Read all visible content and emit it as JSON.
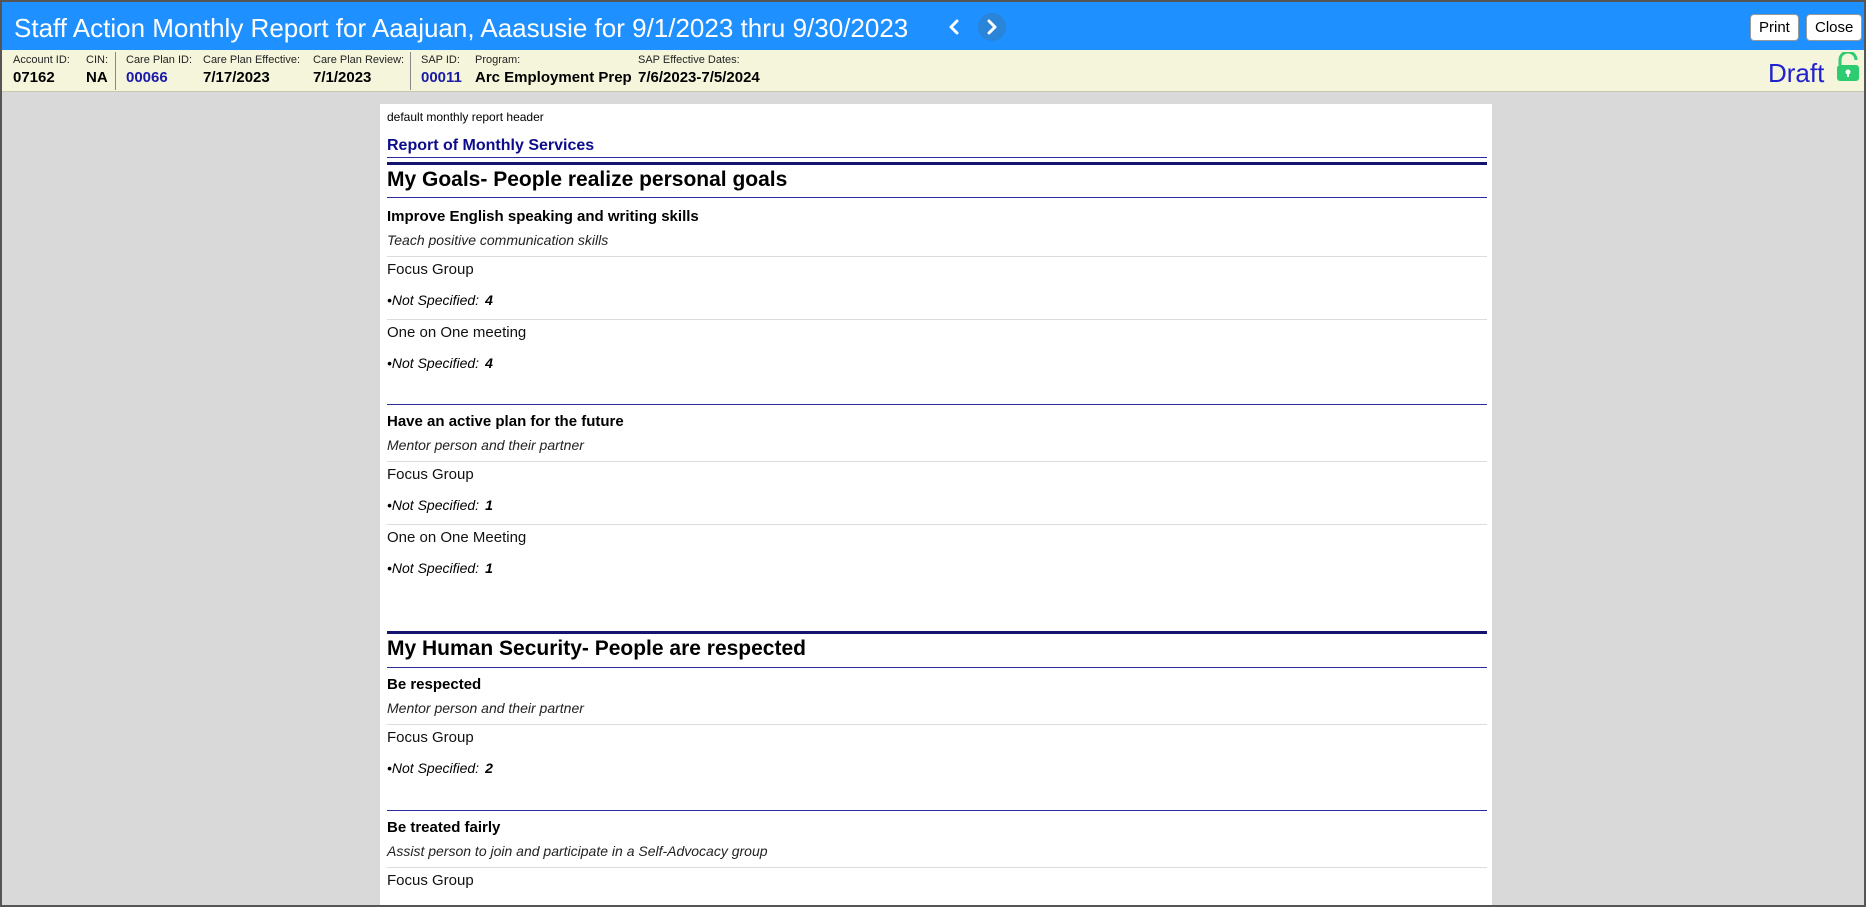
{
  "window": {
    "title": "Staff Action Monthly Report for Aaajuan, Aaasusie for 9/1/2023 thru 9/30/2023",
    "print_label": "Print",
    "close_label": "Close"
  },
  "info": {
    "account_id_label": "Account ID:",
    "account_id": "07162",
    "cin_label": "CIN:",
    "cin": "NA",
    "care_plan_id_label": "Care Plan ID:",
    "care_plan_id": "00066",
    "care_plan_effective_label": "Care Plan Effective:",
    "care_plan_effective": "7/17/2023",
    "care_plan_review_label": "Care Plan Review:",
    "care_plan_review": "7/1/2023",
    "sap_id_label": "SAP ID:",
    "sap_id": "00011",
    "program_label": "Program:",
    "program": "Arc Employment Prep",
    "sap_dates_label": "SAP Effective Dates:",
    "sap_dates": "7/6/2023-7/5/2024",
    "status": "Draft",
    "status_color": "#2222cc",
    "lock_color": "#2ecc71",
    "lock_icon": "unlock-icon"
  },
  "report": {
    "header_text": "default monthly report header",
    "title": "Report of Monthly Services",
    "domains": [
      {
        "name": "My Goals- People realize personal goals",
        "goals": [
          {
            "name": "Improve English speaking and writing skills",
            "action": "Teach positive communication skills",
            "services": [
              {
                "name": "Focus Group",
                "unit": "•Not Specified:",
                "count": "4"
              },
              {
                "name": "One on One meeting",
                "unit": "•Not Specified:",
                "count": "4"
              }
            ]
          },
          {
            "name": "Have an active plan for the future",
            "action": "Mentor person and their partner",
            "services": [
              {
                "name": "Focus Group",
                "unit": "•Not Specified:",
                "count": "1"
              },
              {
                "name": "One on One Meeting",
                "unit": "•Not Specified:",
                "count": "1"
              }
            ]
          }
        ]
      },
      {
        "name": "My Human Security- People are respected",
        "goals": [
          {
            "name": "Be respected",
            "action": "Mentor person and their partner",
            "services": [
              {
                "name": "Focus Group",
                "unit": "•Not Specified:",
                "count": "2"
              }
            ]
          },
          {
            "name": "Be treated fairly",
            "action": "Assist person to join and participate in a Self-Advocacy group",
            "services": [
              {
                "name": "Focus Group"
              }
            ]
          }
        ]
      }
    ]
  }
}
